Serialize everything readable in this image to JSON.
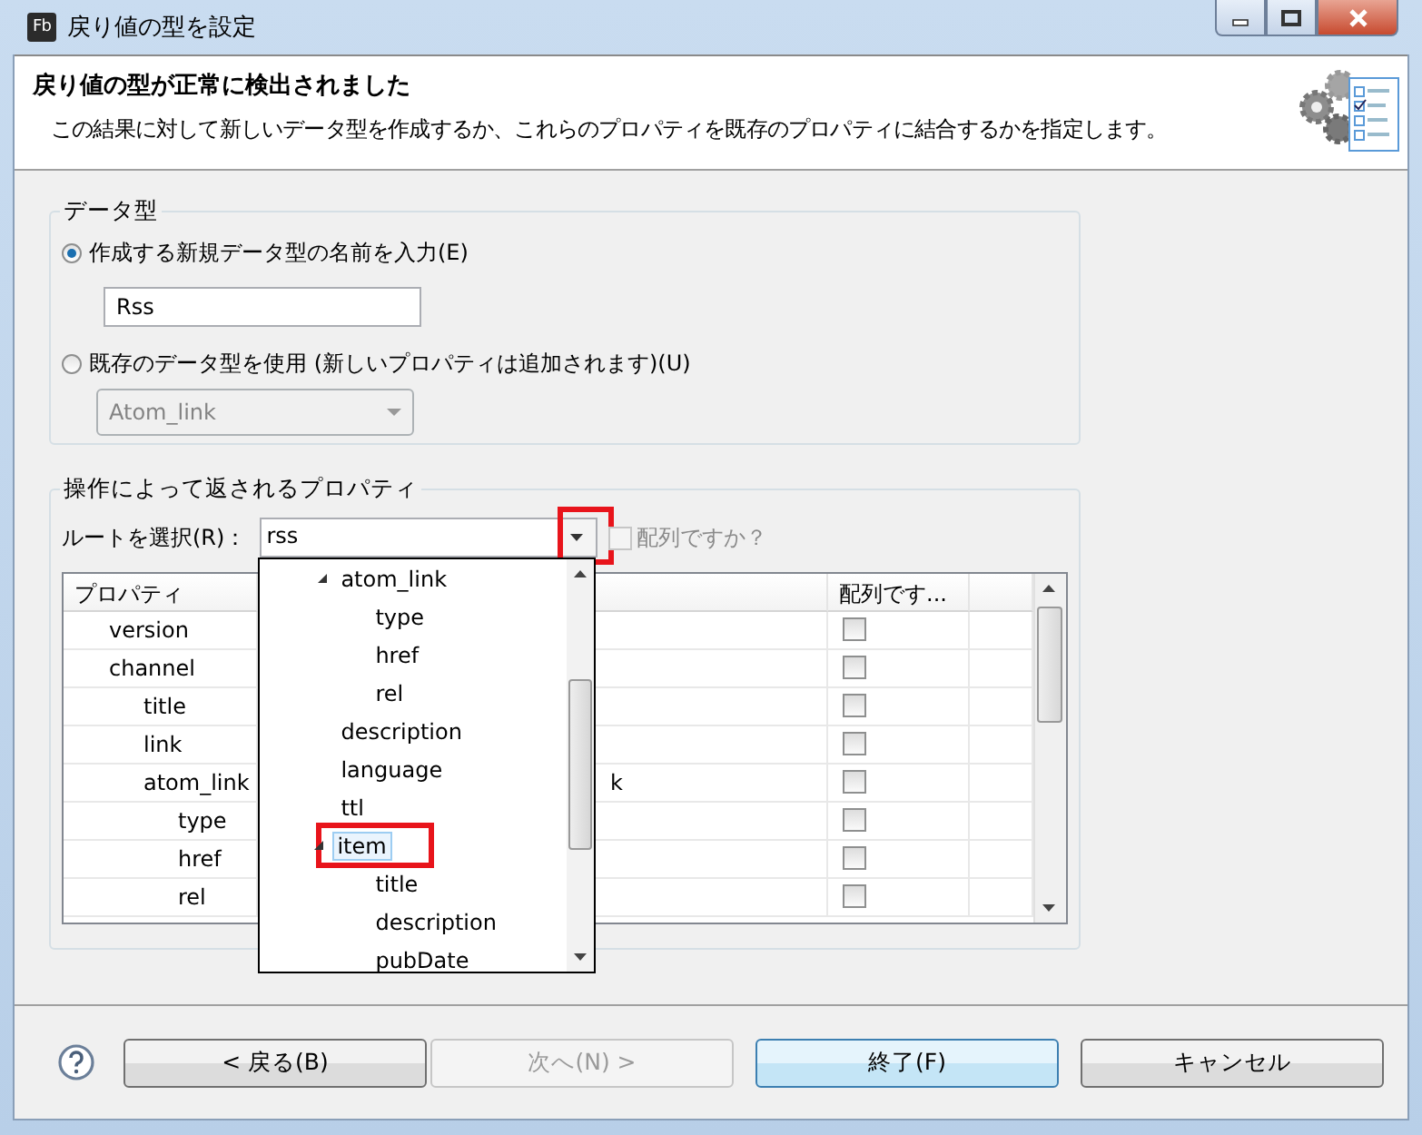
{
  "window": {
    "title": "戻り値の型を設定",
    "app_icon": "Fb"
  },
  "header": {
    "title": "戻り値の型が正常に検出されました",
    "description": "この結果に対して新しいデータ型を作成するか、これらのプロパティを既存のプロパティに結合するかを指定します。"
  },
  "data_type_group": {
    "label": "データ型",
    "options": [
      {
        "kind": "text",
        "label": "作成する新規データ型の名前を入力(E)",
        "selected": true,
        "value": "Rss"
      },
      {
        "kind": "select",
        "label": "既存のデータ型を使用 (新しいプロパティは追加されます)(U)",
        "selected": false,
        "value": "Atom_link"
      }
    ]
  },
  "properties_group": {
    "label": "操作によって返されるプロパティ",
    "root_label": "ルートを選択(R)：",
    "root_value": "rss",
    "root_button_highlighted": true,
    "is_array": {
      "label": "配列ですか？",
      "checked": false
    },
    "table": {
      "columns": [
        "プロパティ",
        "配列です..."
      ],
      "rows": [
        {
          "name": "version",
          "is_array": false
        },
        {
          "name": "channel",
          "is_array": false,
          "children": [
            {
              "name": "title",
              "is_array": false
            },
            {
              "name": "link",
              "is_array": false
            },
            {
              "name": "atom_link",
              "column_2": "k",
              "is_array": false,
              "children": [
                {
                  "name": "type",
                  "is_array": false
                },
                {
                  "name": "href",
                  "is_array": false
                },
                {
                  "name": "rel",
                  "is_array": false
                }
              ]
            }
          ]
        }
      ]
    },
    "dropdown": {
      "items": [
        {
          "label": "atom_link",
          "expanded": true,
          "selected": false,
          "highlighted": false,
          "children": [
            {
              "label": "type",
              "selected": false,
              "highlighted": false
            },
            {
              "label": "href",
              "selected": false,
              "highlighted": false
            },
            {
              "label": "rel",
              "selected": false,
              "highlighted": false
            }
          ]
        },
        {
          "label": "description",
          "selected": false,
          "highlighted": false
        },
        {
          "label": "language",
          "selected": false,
          "highlighted": false
        },
        {
          "label": "ttl",
          "selected": false,
          "highlighted": false
        },
        {
          "label": "item",
          "expanded": true,
          "selected": true,
          "highlighted": true,
          "children": [
            {
              "label": "title",
              "selected": false,
              "highlighted": false
            },
            {
              "label": "description",
              "selected": false,
              "highlighted": false
            },
            {
              "label": "pubDate",
              "selected": false,
              "highlighted": false
            }
          ]
        }
      ]
    }
  },
  "buttons": [
    {
      "label": "< 戻る(B)",
      "disabled": false,
      "default": false
    },
    {
      "label": "次へ(N) >",
      "disabled": true,
      "default": false
    },
    {
      "label": "終了(F)",
      "disabled": false,
      "default": true
    },
    {
      "label": "キャンセル",
      "disabled": false,
      "default": false
    }
  ]
}
